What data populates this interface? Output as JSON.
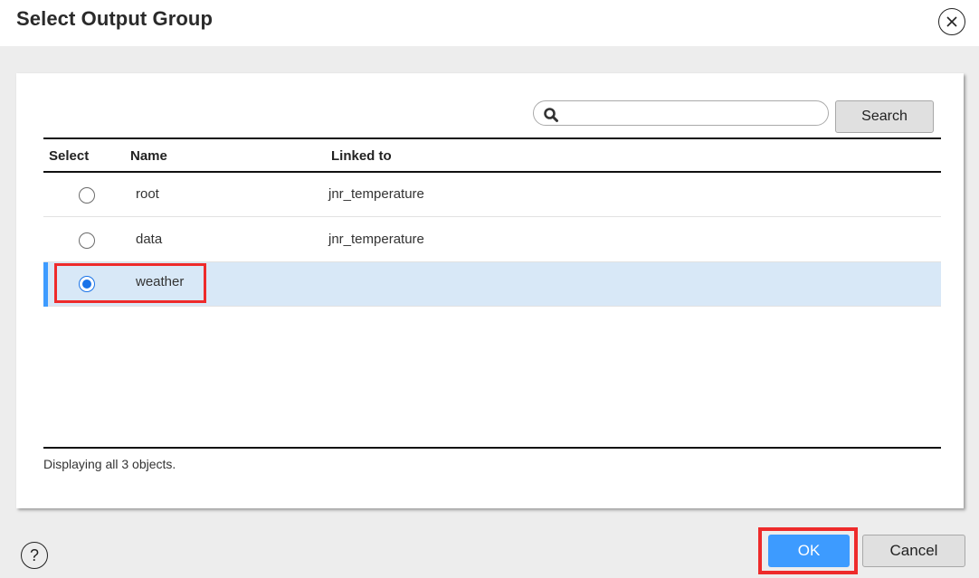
{
  "dialog": {
    "title": "Select Output Group",
    "close_icon": "close-circle-icon",
    "help_icon": "help-circle-icon",
    "help_glyph": "?"
  },
  "search": {
    "placeholder": "",
    "value": "",
    "icon": "search-icon",
    "button_label": "Search"
  },
  "table": {
    "columns": [
      "Select",
      "Name",
      "Linked to"
    ],
    "rows": [
      {
        "name": "root",
        "linked_to": "jnr_temperature",
        "selected": false
      },
      {
        "name": "data",
        "linked_to": "jnr_temperature",
        "selected": false
      },
      {
        "name": "weather",
        "linked_to": "",
        "selected": true
      }
    ],
    "footer": "Displaying all 3 objects."
  },
  "actions": {
    "ok_label": "OK",
    "cancel_label": "Cancel"
  },
  "colors": {
    "accent": "#3d9bff",
    "selected_row": "#d8e8f7",
    "annotation_red": "#ee2b2b"
  }
}
